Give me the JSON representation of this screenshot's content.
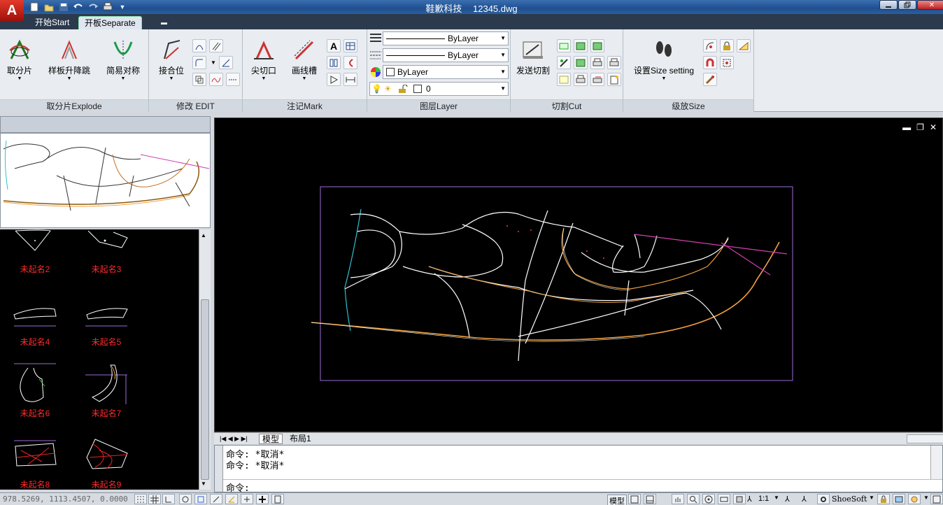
{
  "titlebar": {
    "app_name": "鞋歉科技",
    "file_name": "12345.dwg"
  },
  "tabs": [
    {
      "label": "开始Start"
    },
    {
      "label": "开板Separate"
    }
  ],
  "ribbon": {
    "panels": {
      "explode": {
        "title": "取分片Explode",
        "buttons": [
          "取分片",
          "样板升降跳",
          "简易对称"
        ]
      },
      "edit": {
        "title": "修改 EDIT",
        "buttons": [
          "接合位"
        ]
      },
      "mark": {
        "title": "注记Mark",
        "buttons": [
          "尖切口",
          "画线槽"
        ]
      },
      "layer": {
        "title": "图层Layer",
        "linetype": "ByLayer",
        "lineweight": "ByLayer",
        "color": "ByLayer",
        "layer_name": "0"
      },
      "cut": {
        "title": "切割Cut",
        "buttons": [
          "发送切割"
        ]
      },
      "size": {
        "title": "级放Size",
        "buttons": [
          "设置Size setting"
        ]
      }
    }
  },
  "palette": {
    "thumbnails": [
      "未起名2",
      "未起名3",
      "未起名4",
      "未起名5",
      "未起名6",
      "未起名7",
      "未起名8",
      "未起名9"
    ]
  },
  "layout_tabs": [
    "模型",
    "布局1"
  ],
  "command": {
    "history": [
      "命令: *取消*",
      "命令: *取消*"
    ],
    "prompt": "命令:"
  },
  "status": {
    "coords": "978.5269,  1113.4507, 0.0000",
    "model_label": "模型",
    "scale": "1:1",
    "workspace": "ShoeSoft"
  },
  "colors": {
    "accent": "#1f4f8f",
    "viewport_bg": "#000000",
    "caption_red": "#ff2a2a"
  }
}
